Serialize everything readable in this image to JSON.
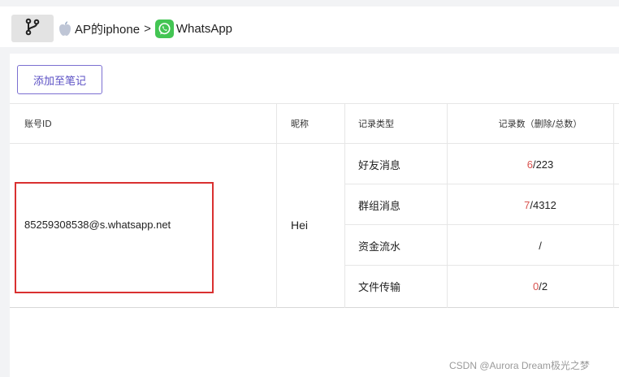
{
  "breadcrumb": {
    "device": "AP的iphone",
    "separator": ">",
    "app": "WhatsApp"
  },
  "toolbar": {
    "add_to_notes_label": "添加至笔记"
  },
  "table": {
    "headers": {
      "account_id": "账号ID",
      "nickname": "昵称",
      "record_type": "记录类型",
      "record_count": "记录数（删除/总数）"
    },
    "row": {
      "account_id": "85259308538@s.whatsapp.net",
      "nickname": "Hei",
      "records": [
        {
          "type": "好友消息",
          "deleted": "6",
          "slash": "/",
          "total": "223"
        },
        {
          "type": "群组消息",
          "deleted": "7",
          "slash": "/",
          "total": "4312"
        },
        {
          "type": "资金流水",
          "deleted": "",
          "slash": "/",
          "total": ""
        },
        {
          "type": "文件传输",
          "deleted": "0",
          "slash": "/",
          "total": "2"
        }
      ]
    }
  },
  "colors": {
    "highlight_box": "#d93030",
    "deleted_count": "#d9534f",
    "button_border": "#7b6fd1",
    "whatsapp_green": "#43c553"
  },
  "watermark": "CSDN @Aurora Dream极光之梦"
}
